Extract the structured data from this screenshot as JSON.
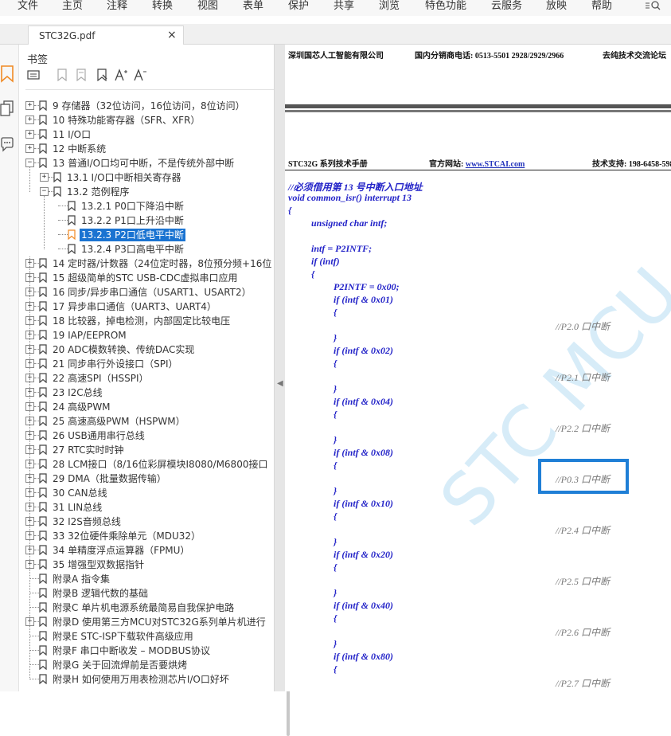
{
  "menu": [
    "文件",
    "主页",
    "注释",
    "转换",
    "视图",
    "表单",
    "保护",
    "共享",
    "浏览",
    "特色功能",
    "云服务",
    "放映",
    "帮助"
  ],
  "tab": {
    "title": "STC32G.pdf",
    "close": "×"
  },
  "bookmarks": {
    "title": "书签",
    "items": [
      {
        "label": "9 存储器（32位访问，16位访问，8位访问）"
      },
      {
        "label": "10 特殊功能寄存器（SFR、XFR）"
      },
      {
        "label": "11 I/O口"
      },
      {
        "label": "12 中断系统"
      },
      {
        "label": "13 普通I/O口均可中断，不是传统外部中断"
      },
      {
        "label": "13.1 I/O口中断相关寄存器"
      },
      {
        "label": "13.2 范例程序"
      },
      {
        "label": "13.2.1 P0口下降沿中断"
      },
      {
        "label": "13.2.2 P1口上升沿中断"
      },
      {
        "label": "13.2.3 P2口低电平中断"
      },
      {
        "label": "13.2.4 P3口高电平中断"
      },
      {
        "label": "14 定时器/计数器（24位定时器，8位预分频+16位"
      },
      {
        "label": "15 超级简单的STC USB-CDC虚拟串口应用"
      },
      {
        "label": "16 同步/异步串口通信（USART1、USART2）"
      },
      {
        "label": "17 异步串口通信（UART3、UART4）"
      },
      {
        "label": "18 比较器，掉电检测，内部固定比较电压"
      },
      {
        "label": "19 IAP/EEPROM"
      },
      {
        "label": "20 ADC模数转换、传统DAC实现"
      },
      {
        "label": "21 同步串行外设接口（SPI）"
      },
      {
        "label": "22 高速SPI（HSSPI）"
      },
      {
        "label": "23 I2C总线"
      },
      {
        "label": "24 高级PWM"
      },
      {
        "label": "25 高速高级PWM（HSPWM）"
      },
      {
        "label": "26 USB通用串行总线"
      },
      {
        "label": "27 RTC实时时钟"
      },
      {
        "label": "28 LCM接口（8/16位彩屏模块I8080/M6800接口"
      },
      {
        "label": "29 DMA（批量数据传输）"
      },
      {
        "label": "30 CAN总线"
      },
      {
        "label": "31 LIN总线"
      },
      {
        "label": "32 I2S音频总线"
      },
      {
        "label": "33 32位硬件乘除单元（MDU32）"
      },
      {
        "label": "34 单精度浮点运算器（FPMU）"
      },
      {
        "label": "35 增强型双数据指针"
      },
      {
        "label": "附录A 指令集"
      },
      {
        "label": "附录B 逻辑代数的基础"
      },
      {
        "label": "附录C 单片机电源系统最简易自我保护电路"
      },
      {
        "label": "附录D 使用第三方MCU对STC32G系列单片机进行"
      },
      {
        "label": "附录E STC-ISP下载软件高级应用"
      },
      {
        "label": "附录F 串口中断收发 – MODBUS协议"
      },
      {
        "label": "附录G 关于回流焊前是否要烘烤"
      },
      {
        "label": "附录H 如何使用万用表检测芯片I/O口好坏"
      }
    ]
  },
  "document": {
    "header": {
      "company": "深圳国芯人工智能有限公司",
      "phone": "国内分销商电话: 0513-5501 2928/2929/2966",
      "forum": "去纯技术交流论坛"
    },
    "footer": {
      "manual": "STC32G 系列技术手册",
      "site_label": "官方网站:",
      "site": "www.STCAI.com",
      "support": "技术支持: 198-6458-598"
    },
    "code_lines": [
      "//必须借用第 13 号中断入口地址",
      "void common_isr() interrupt 13",
      "{",
      "unsigned char intf;",
      "intf = P2INTF;",
      "if (intf)",
      "{",
      "P2INTF = 0x00;",
      "if (intf & 0x01)",
      "{",
      "//P2.0 口中断",
      "}",
      "if (intf & 0x02)",
      "{",
      "//P2.1 口中断",
      "}",
      "if (intf & 0x04)",
      "{",
      "//P2.2 口中断",
      "}",
      "if (intf & 0x08)",
      "{",
      "//P0.3 口中断",
      "}",
      "if (intf & 0x10)",
      "{",
      "//P2.4 口中断",
      "}",
      "if (intf & 0x20)",
      "{",
      "//P2.5 口中断",
      "}",
      "if (intf & 0x40)",
      "{",
      "//P2.6 口中断",
      "}",
      "if (intf & 0x80)",
      "{",
      "//P2.7 口中断"
    ],
    "watermark": "STC MCU"
  },
  "colors": {
    "selection": "#1a73d1",
    "code": "#2323c8",
    "comment": "#7a7a7a",
    "focus_box": "#1f7fd6"
  }
}
